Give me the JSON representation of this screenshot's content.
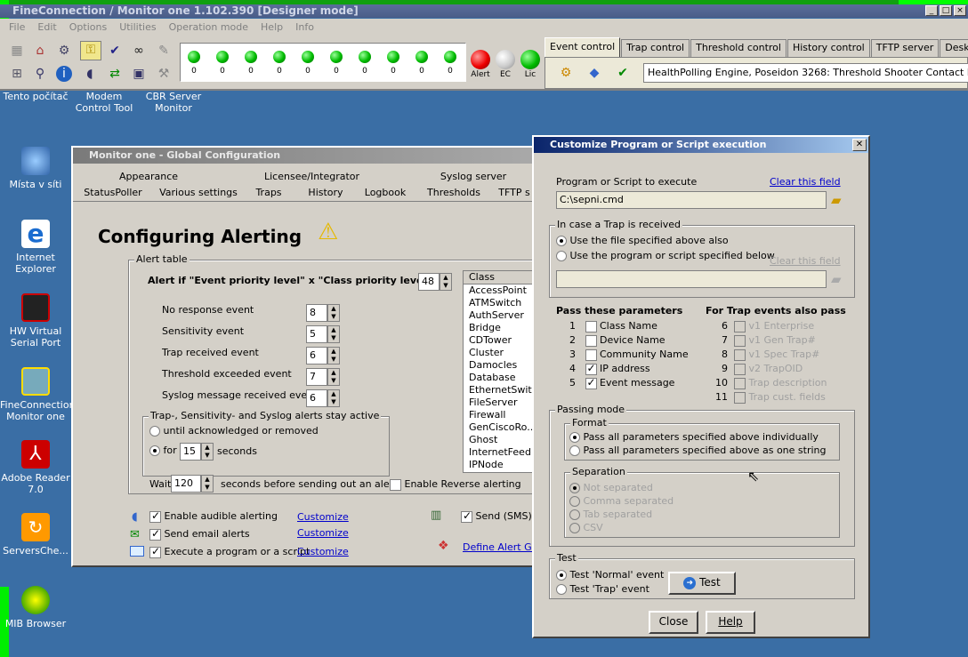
{
  "app": {
    "title": "FineConnection / Monitor one 1.102.390 [Designer mode]"
  },
  "menu": [
    "File",
    "Edit",
    "Options",
    "Utilities",
    "Operation mode",
    "Help",
    "Info"
  ],
  "leds": {
    "counts": [
      "0",
      "0",
      "0",
      "0",
      "0",
      "0",
      "0",
      "0",
      "0",
      "0"
    ],
    "alert": "Alert",
    "ec": "EC",
    "lic": "Lic"
  },
  "top_tabs": [
    "Event control",
    "Trap control",
    "Threshold control",
    "History control",
    "TFTP server",
    "Desktop"
  ],
  "event_message": "HealthPolling Engine, Poseidon 3268: Threshold Shooter Contact has no Sh",
  "desktop_icons": [
    "Tento počítač",
    "Modem Control Tool",
    "CBR Server Monitor",
    "Místa v síti",
    "Internet Explorer",
    "HW Virtual Serial Port",
    "FineConnection Monitor one",
    "Adobe Reader 7.0",
    "ServersChe...",
    "MIB Browser"
  ],
  "global": {
    "title": "Monitor one - Global Configuration",
    "tabs_row1": [
      "Appearance",
      "Licensee/Integrator",
      "Syslog server"
    ],
    "tabs_row2": [
      "StatusPoller",
      "Various settings",
      "Traps",
      "History",
      "Logbook",
      "Thresholds",
      "TFTP s"
    ],
    "heading": "Configuring Alerting",
    "alert_table": "Alert table",
    "alert_if": "Alert if \"Event priority level\" x \"Class priority level\" >",
    "threshold_value": "48",
    "rows": [
      {
        "label": "No response event",
        "value": "8"
      },
      {
        "label": "Sensitivity event",
        "value": "5"
      },
      {
        "label": "Trap received event",
        "value": "6"
      },
      {
        "label": "Threshold exceeded event",
        "value": "7"
      },
      {
        "label": "Syslog message received event",
        "value": "6"
      }
    ],
    "stay_active": "Trap-, Sensitivity- and Syslog alerts stay active",
    "until_ack": "until acknowledged or removed",
    "for": "for",
    "for_value": "15",
    "seconds": "seconds",
    "wait": "Wait",
    "wait_value": "120",
    "wait_suffix": "seconds before sending out an alert!",
    "enable_reverse": "Enable Reverse alerting",
    "class_header": "Class",
    "classes": [
      "AccessPoint",
      "ATMSwitch",
      "AuthServer",
      "Bridge",
      "CDTower",
      "Cluster",
      "Damocles",
      "Database",
      "EthernetSwitch",
      "FileServer",
      "Firewall",
      "GenCiscoRo...",
      "Ghost",
      "InternetFeed",
      "IPNode"
    ],
    "audible": "Enable audible alerting",
    "email": "Send email alerts",
    "execute": "Execute a program or a script",
    "customize": "Customize",
    "sms": "Send (SMS) ...",
    "define_group": "Define Alert Grou"
  },
  "dialog": {
    "title": "Customize Program or Script execution",
    "program_label": "Program or Script to execute",
    "clear_field": "Clear this field",
    "program_value": "C:\\sepni.cmd",
    "trap_group": "In case a Trap is received",
    "use_file": "Use the file specified above also",
    "use_program": "Use the program or script specified below",
    "pass_params": "Pass these parameters",
    "for_trap": "For Trap events also pass",
    "params": [
      {
        "n": "1",
        "label": "Class Name",
        "checked": false
      },
      {
        "n": "2",
        "label": "Device Name",
        "checked": false
      },
      {
        "n": "3",
        "label": "Community Name",
        "checked": false
      },
      {
        "n": "4",
        "label": "IP address",
        "checked": true
      },
      {
        "n": "5",
        "label": "Event message",
        "checked": true
      }
    ],
    "trap_params": [
      {
        "n": "6",
        "label": "v1 Enterprise"
      },
      {
        "n": "7",
        "label": "v1 Gen Trap#"
      },
      {
        "n": "8",
        "label": "v1 Spec Trap#"
      },
      {
        "n": "9",
        "label": "v2 TrapOID"
      },
      {
        "n": "10",
        "label": "Trap description"
      },
      {
        "n": "11",
        "label": "Trap cust. fields"
      }
    ],
    "passing_mode": "Passing mode",
    "format": "Format",
    "individually": "Pass all parameters specified above individually",
    "one_string": "Pass all parameters specified above as one string",
    "separation": "Separation",
    "separations": [
      "Not separated",
      "Comma separated",
      "Tab separated",
      "CSV"
    ],
    "test": "Test",
    "test_normal": "Test 'Normal' event",
    "test_trap": "Test 'Trap' event",
    "test_button": "Test",
    "close": "Close",
    "help": "Help"
  }
}
